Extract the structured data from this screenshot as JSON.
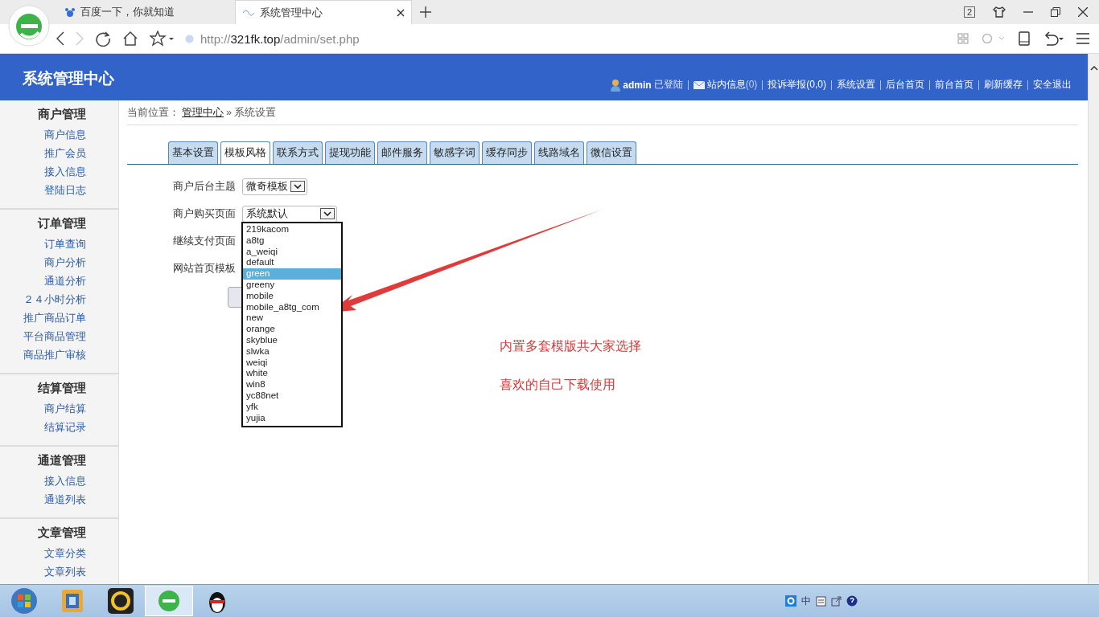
{
  "browser": {
    "tabs": [
      {
        "title": "百度一下，你就知道",
        "selected": false
      },
      {
        "title": "系统管理中心",
        "selected": true
      }
    ],
    "tab_count": "2",
    "address_scheme": "http://",
    "address_host": "321fk.top",
    "address_path": "/admin/set.php"
  },
  "header": {
    "title": "系统管理中心",
    "user": "admin",
    "user_status": "已登陆",
    "links": [
      {
        "label": "站内信息",
        "count": "(0)"
      },
      {
        "label": "投诉举报(0,0)"
      },
      {
        "label": "系统设置"
      },
      {
        "label": "后台首页"
      },
      {
        "label": "前台首页"
      },
      {
        "label": "刷新缓存"
      },
      {
        "label": "安全退出"
      }
    ]
  },
  "sidebar": {
    "groups": [
      {
        "title": "商户管理",
        "items": [
          "商户信息",
          "推广会员",
          "接入信息",
          "登陆日志"
        ]
      },
      {
        "title": "订单管理",
        "items": [
          "订单查询",
          "商户分析",
          "通道分析",
          "２４小时分析",
          "推广商品订单",
          "平台商品管理",
          "商品推广审核"
        ]
      },
      {
        "title": "结算管理",
        "items": [
          "商户结算",
          "结算记录"
        ]
      },
      {
        "title": "通道管理",
        "items": [
          "接入信息",
          "通道列表"
        ]
      },
      {
        "title": "文章管理",
        "items": [
          "文章分类",
          "文章列表"
        ]
      }
    ]
  },
  "breadcrumb": {
    "prefix": "当前位置：",
    "link": "管理中心",
    "separator": "»",
    "current": "系统设置"
  },
  "tabs": [
    {
      "label": "基本设置",
      "selected": false
    },
    {
      "label": "模板风格",
      "selected": true
    },
    {
      "label": "联系方式",
      "selected": false
    },
    {
      "label": "提现功能",
      "selected": false
    },
    {
      "label": "邮件服务",
      "selected": false
    },
    {
      "label": "敏感字词",
      "selected": false
    },
    {
      "label": "缓存同步",
      "selected": false
    },
    {
      "label": "线路域名",
      "selected": false
    },
    {
      "label": "微信设置",
      "selected": false
    }
  ],
  "form": {
    "rows": [
      {
        "label": "商户后台主题",
        "value": "微奇模板"
      },
      {
        "label": "商户购买页面",
        "value": "系统默认"
      },
      {
        "label": "继续支付页面"
      },
      {
        "label": "网站首页模板"
      }
    ]
  },
  "dropdown": {
    "options": [
      {
        "label": "219kacom",
        "selected": false
      },
      {
        "label": "a8tg",
        "selected": false
      },
      {
        "label": "a_weiqi",
        "selected": false
      },
      {
        "label": "default",
        "selected": false
      },
      {
        "label": "green",
        "selected": true
      },
      {
        "label": "greeny",
        "selected": false
      },
      {
        "label": "mobile",
        "selected": false
      },
      {
        "label": "mobile_a8tg_com",
        "selected": false
      },
      {
        "label": "new",
        "selected": false
      },
      {
        "label": "orange",
        "selected": false
      },
      {
        "label": "skyblue",
        "selected": false
      },
      {
        "label": "slwka",
        "selected": false
      },
      {
        "label": "weiqi",
        "selected": false
      },
      {
        "label": "white",
        "selected": false
      },
      {
        "label": "win8",
        "selected": false
      },
      {
        "label": "yc88net",
        "selected": false
      },
      {
        "label": "yfk",
        "selected": false
      },
      {
        "label": "yujia",
        "selected": false
      }
    ]
  },
  "annotations": [
    "内置多套模版共大家选择",
    "喜欢的自己下载使用"
  ],
  "taskbar": {
    "tray_text": "中"
  }
}
